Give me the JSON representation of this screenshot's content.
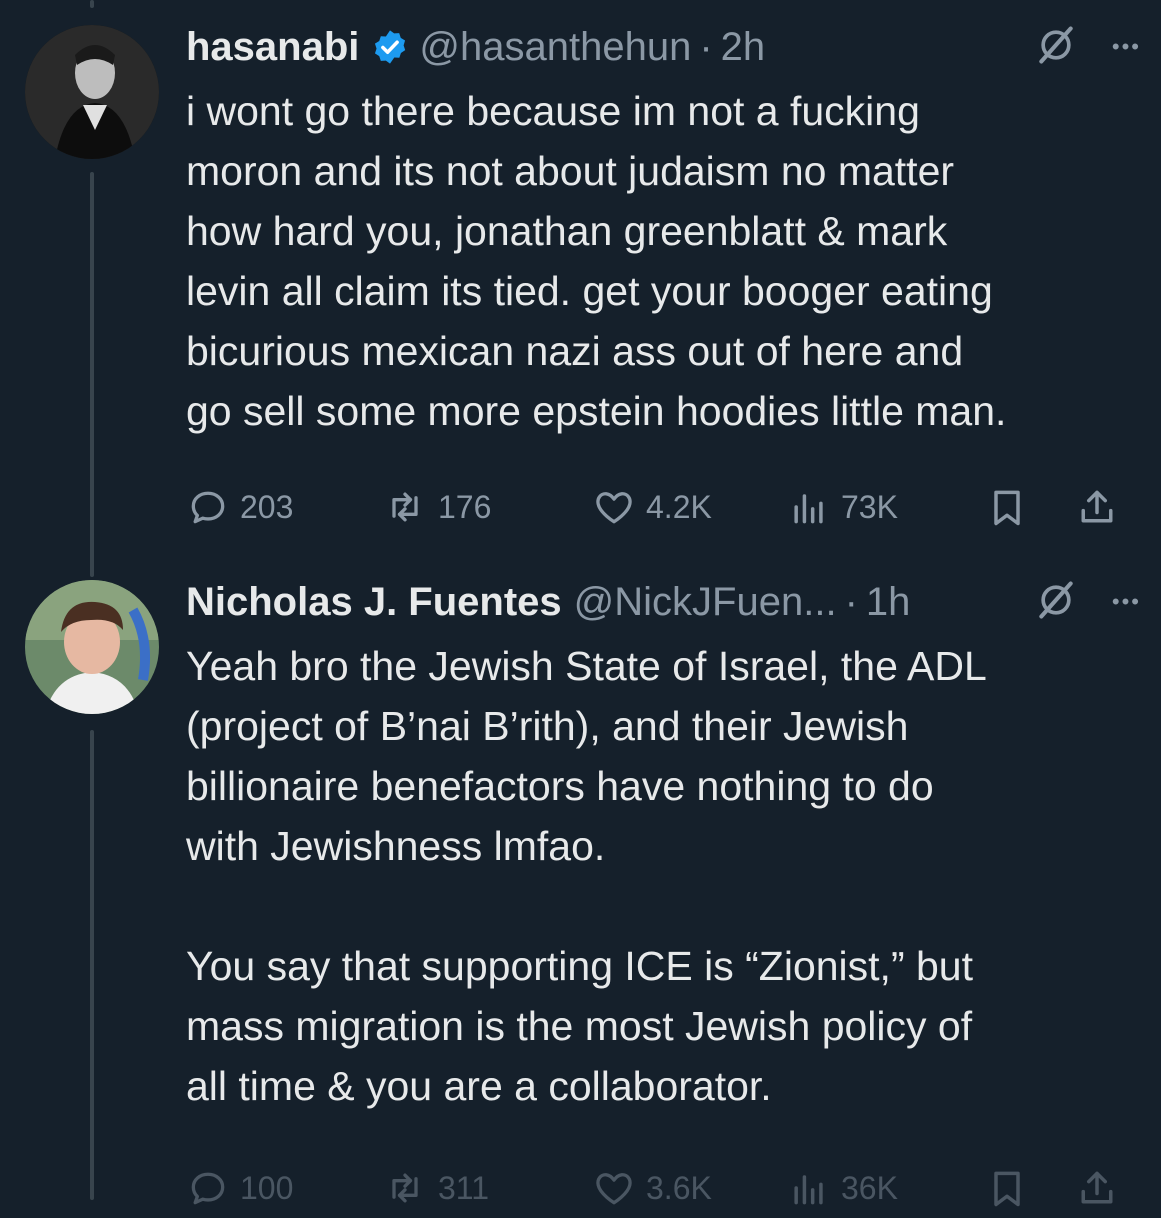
{
  "tweets": [
    {
      "name": "hasanabi",
      "handle": "@hasanthehun",
      "time": "2h",
      "text_lines": [
        "i wont go there because im not a fucking",
        "moron and its not about judaism no matter",
        "how hard you, jonathan greenblatt & mark",
        "levin all claim its tied. get your booger eating",
        "bicurious mexican nazi ass out of here and",
        "go sell some more epstein hoodies little man."
      ],
      "replies": "203",
      "reposts": "176",
      "likes": "4.2K",
      "views": "73K",
      "verified": true
    },
    {
      "name": "Nicholas J. Fuentes",
      "handle": "@NickJFuen...",
      "time": "1h",
      "text_lines": [
        "Yeah bro the Jewish State of Israel, the ADL",
        "(project of B’nai B’rith), and their Jewish",
        "billionaire benefactors have nothing to do",
        "with Jewishness lmfao."
      ],
      "text_lines_2": [
        "You say that supporting ICE is “Zionist,” but",
        "mass migration is the most Jewish policy of",
        "all time & you are a collaborator."
      ],
      "replies": "100",
      "reposts": "311",
      "likes": "3.6K",
      "views": "36K",
      "verified": false
    }
  ],
  "icons": {
    "verified_badge_color": "#1d9bf0",
    "muted_icon_color": "#8b98a5",
    "dot_separator": "·",
    "more": "•••"
  }
}
